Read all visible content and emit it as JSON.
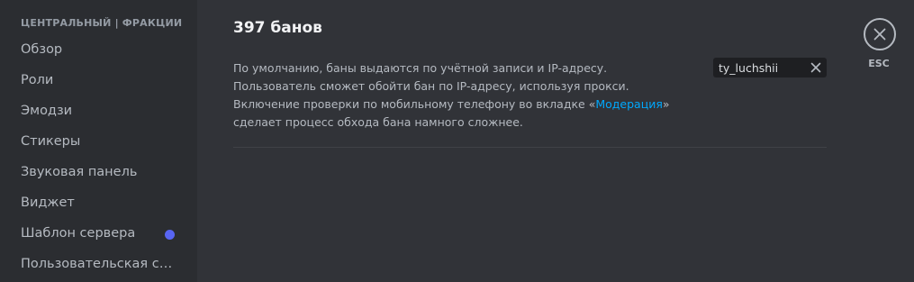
{
  "sidebar": {
    "header": "ЦЕНТРАЛЬНЫЙ | ФРАКЦИИ",
    "items": [
      {
        "label": "Обзор"
      },
      {
        "label": "Роли"
      },
      {
        "label": "Эмодзи"
      },
      {
        "label": "Стикеры"
      },
      {
        "label": "Звуковая панель"
      },
      {
        "label": "Виджет"
      },
      {
        "label": "Шаблон сервера",
        "badge_color": "#5865f2"
      },
      {
        "label": "Пользовательская сс..."
      }
    ]
  },
  "main": {
    "title": "397 банов",
    "description": {
      "before_link": "По умолчанию, баны выдаются по учётной записи и IP-адресу. Пользователь сможет обойти бан по IP-адресу, используя прокси. Включение проверки по мобильному телефону во вкладке «",
      "link": "Модерация",
      "after_link": "» сделает процесс обхода бана намного сложнее."
    },
    "search": {
      "value": "ty_luchshii",
      "clear_icon": "close-icon"
    },
    "close": {
      "icon": "close-icon",
      "label": "ESC"
    }
  },
  "colors": {
    "background": "#313338",
    "sidebar": "#2b2d31",
    "accent": "#5865f2",
    "link": "#00a8fc"
  }
}
